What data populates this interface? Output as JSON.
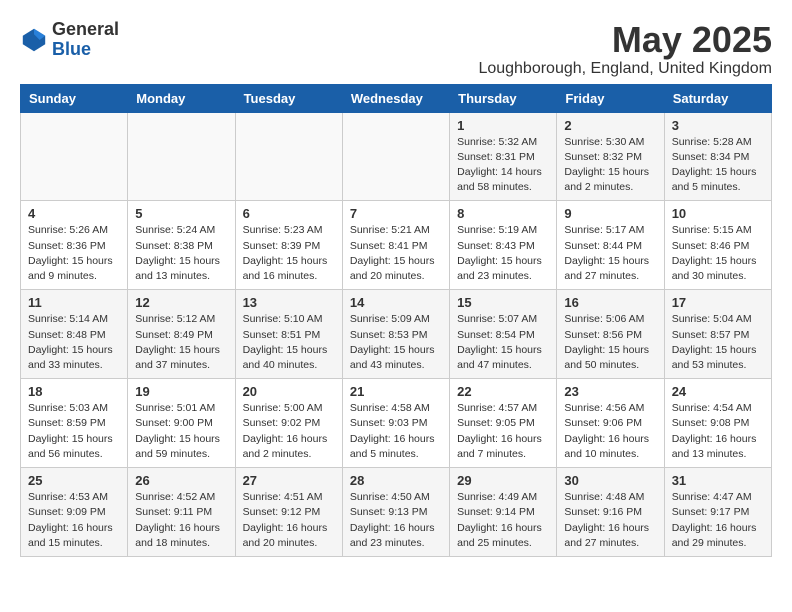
{
  "logo": {
    "general": "General",
    "blue": "Blue"
  },
  "title": "May 2025",
  "location": "Loughborough, England, United Kingdom",
  "days_of_week": [
    "Sunday",
    "Monday",
    "Tuesday",
    "Wednesday",
    "Thursday",
    "Friday",
    "Saturday"
  ],
  "weeks": [
    [
      {
        "day": "",
        "info": ""
      },
      {
        "day": "",
        "info": ""
      },
      {
        "day": "",
        "info": ""
      },
      {
        "day": "",
        "info": ""
      },
      {
        "day": "1",
        "info": "Sunrise: 5:32 AM\nSunset: 8:31 PM\nDaylight: 14 hours\nand 58 minutes."
      },
      {
        "day": "2",
        "info": "Sunrise: 5:30 AM\nSunset: 8:32 PM\nDaylight: 15 hours\nand 2 minutes."
      },
      {
        "day": "3",
        "info": "Sunrise: 5:28 AM\nSunset: 8:34 PM\nDaylight: 15 hours\nand 5 minutes."
      }
    ],
    [
      {
        "day": "4",
        "info": "Sunrise: 5:26 AM\nSunset: 8:36 PM\nDaylight: 15 hours\nand 9 minutes."
      },
      {
        "day": "5",
        "info": "Sunrise: 5:24 AM\nSunset: 8:38 PM\nDaylight: 15 hours\nand 13 minutes."
      },
      {
        "day": "6",
        "info": "Sunrise: 5:23 AM\nSunset: 8:39 PM\nDaylight: 15 hours\nand 16 minutes."
      },
      {
        "day": "7",
        "info": "Sunrise: 5:21 AM\nSunset: 8:41 PM\nDaylight: 15 hours\nand 20 minutes."
      },
      {
        "day": "8",
        "info": "Sunrise: 5:19 AM\nSunset: 8:43 PM\nDaylight: 15 hours\nand 23 minutes."
      },
      {
        "day": "9",
        "info": "Sunrise: 5:17 AM\nSunset: 8:44 PM\nDaylight: 15 hours\nand 27 minutes."
      },
      {
        "day": "10",
        "info": "Sunrise: 5:15 AM\nSunset: 8:46 PM\nDaylight: 15 hours\nand 30 minutes."
      }
    ],
    [
      {
        "day": "11",
        "info": "Sunrise: 5:14 AM\nSunset: 8:48 PM\nDaylight: 15 hours\nand 33 minutes."
      },
      {
        "day": "12",
        "info": "Sunrise: 5:12 AM\nSunset: 8:49 PM\nDaylight: 15 hours\nand 37 minutes."
      },
      {
        "day": "13",
        "info": "Sunrise: 5:10 AM\nSunset: 8:51 PM\nDaylight: 15 hours\nand 40 minutes."
      },
      {
        "day": "14",
        "info": "Sunrise: 5:09 AM\nSunset: 8:53 PM\nDaylight: 15 hours\nand 43 minutes."
      },
      {
        "day": "15",
        "info": "Sunrise: 5:07 AM\nSunset: 8:54 PM\nDaylight: 15 hours\nand 47 minutes."
      },
      {
        "day": "16",
        "info": "Sunrise: 5:06 AM\nSunset: 8:56 PM\nDaylight: 15 hours\nand 50 minutes."
      },
      {
        "day": "17",
        "info": "Sunrise: 5:04 AM\nSunset: 8:57 PM\nDaylight: 15 hours\nand 53 minutes."
      }
    ],
    [
      {
        "day": "18",
        "info": "Sunrise: 5:03 AM\nSunset: 8:59 PM\nDaylight: 15 hours\nand 56 minutes."
      },
      {
        "day": "19",
        "info": "Sunrise: 5:01 AM\nSunset: 9:00 PM\nDaylight: 15 hours\nand 59 minutes."
      },
      {
        "day": "20",
        "info": "Sunrise: 5:00 AM\nSunset: 9:02 PM\nDaylight: 16 hours\nand 2 minutes."
      },
      {
        "day": "21",
        "info": "Sunrise: 4:58 AM\nSunset: 9:03 PM\nDaylight: 16 hours\nand 5 minutes."
      },
      {
        "day": "22",
        "info": "Sunrise: 4:57 AM\nSunset: 9:05 PM\nDaylight: 16 hours\nand 7 minutes."
      },
      {
        "day": "23",
        "info": "Sunrise: 4:56 AM\nSunset: 9:06 PM\nDaylight: 16 hours\nand 10 minutes."
      },
      {
        "day": "24",
        "info": "Sunrise: 4:54 AM\nSunset: 9:08 PM\nDaylight: 16 hours\nand 13 minutes."
      }
    ],
    [
      {
        "day": "25",
        "info": "Sunrise: 4:53 AM\nSunset: 9:09 PM\nDaylight: 16 hours\nand 15 minutes."
      },
      {
        "day": "26",
        "info": "Sunrise: 4:52 AM\nSunset: 9:11 PM\nDaylight: 16 hours\nand 18 minutes."
      },
      {
        "day": "27",
        "info": "Sunrise: 4:51 AM\nSunset: 9:12 PM\nDaylight: 16 hours\nand 20 minutes."
      },
      {
        "day": "28",
        "info": "Sunrise: 4:50 AM\nSunset: 9:13 PM\nDaylight: 16 hours\nand 23 minutes."
      },
      {
        "day": "29",
        "info": "Sunrise: 4:49 AM\nSunset: 9:14 PM\nDaylight: 16 hours\nand 25 minutes."
      },
      {
        "day": "30",
        "info": "Sunrise: 4:48 AM\nSunset: 9:16 PM\nDaylight: 16 hours\nand 27 minutes."
      },
      {
        "day": "31",
        "info": "Sunrise: 4:47 AM\nSunset: 9:17 PM\nDaylight: 16 hours\nand 29 minutes."
      }
    ]
  ]
}
